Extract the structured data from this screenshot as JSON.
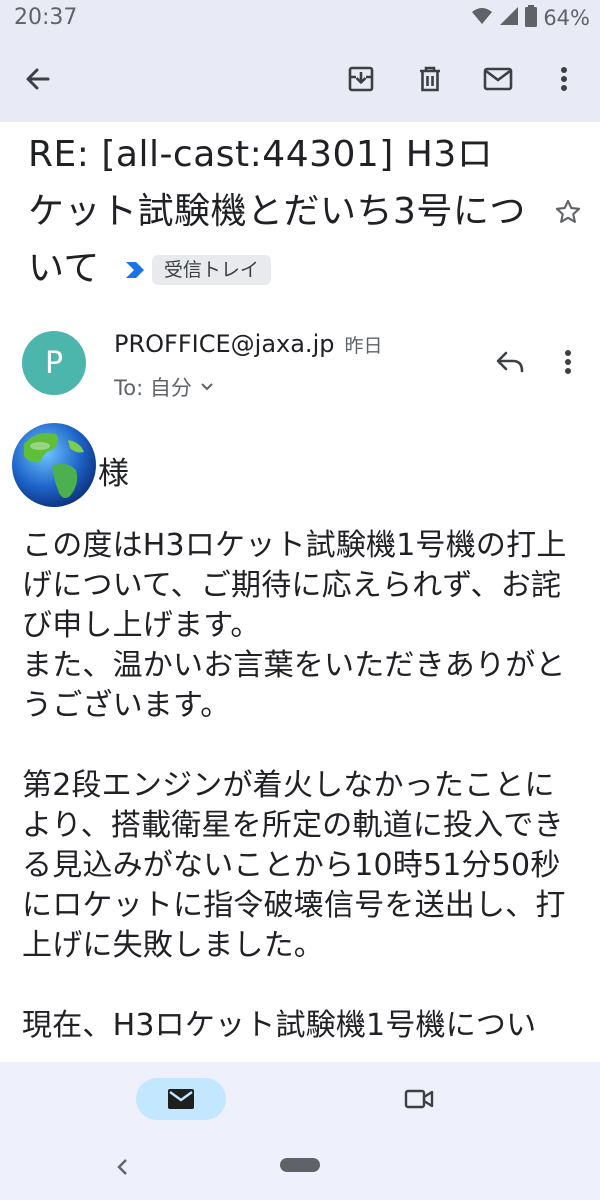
{
  "status_bar": {
    "time": "20:37",
    "battery_percent": "64%",
    "icons": [
      "wifi-icon",
      "signal-icon",
      "battery-icon"
    ]
  },
  "app_bar": {
    "icons": [
      "back-arrow-icon",
      "archive-icon",
      "delete-icon",
      "mark-unread-icon",
      "more-vert-icon"
    ]
  },
  "email": {
    "subject": "RE: [all-cast:44301] H3ロケット試験機とだいち3号について",
    "label": "受信トレイ",
    "label_color": "#1a73e8",
    "sender": {
      "avatar_letter": "P",
      "avatar_color": "#4db6ac",
      "address": "PROFFICE@jaxa.jp",
      "time": "昨日",
      "to": "To: 自分"
    },
    "salutation": "様",
    "body": "この度はH3ロケット試験機1号機の打上げについて、ご期待に応えられず、お詫び申し上げます。\nまた、温かいお言葉をいただきありがとうございます。\n\n第2段エンジンが着火しなかったことにより、搭載衛星を所定の軌道に投入できる見込みがないことから10時51分50秒にロケットに指令破壊信号を送出し、打上げに失敗しました。\n\n現在、H3ロケット試験機1号機につい"
  },
  "bottom_nav": {
    "items": [
      "mail-icon",
      "meet-video-icon"
    ],
    "active_color": "#c2e7ff"
  }
}
